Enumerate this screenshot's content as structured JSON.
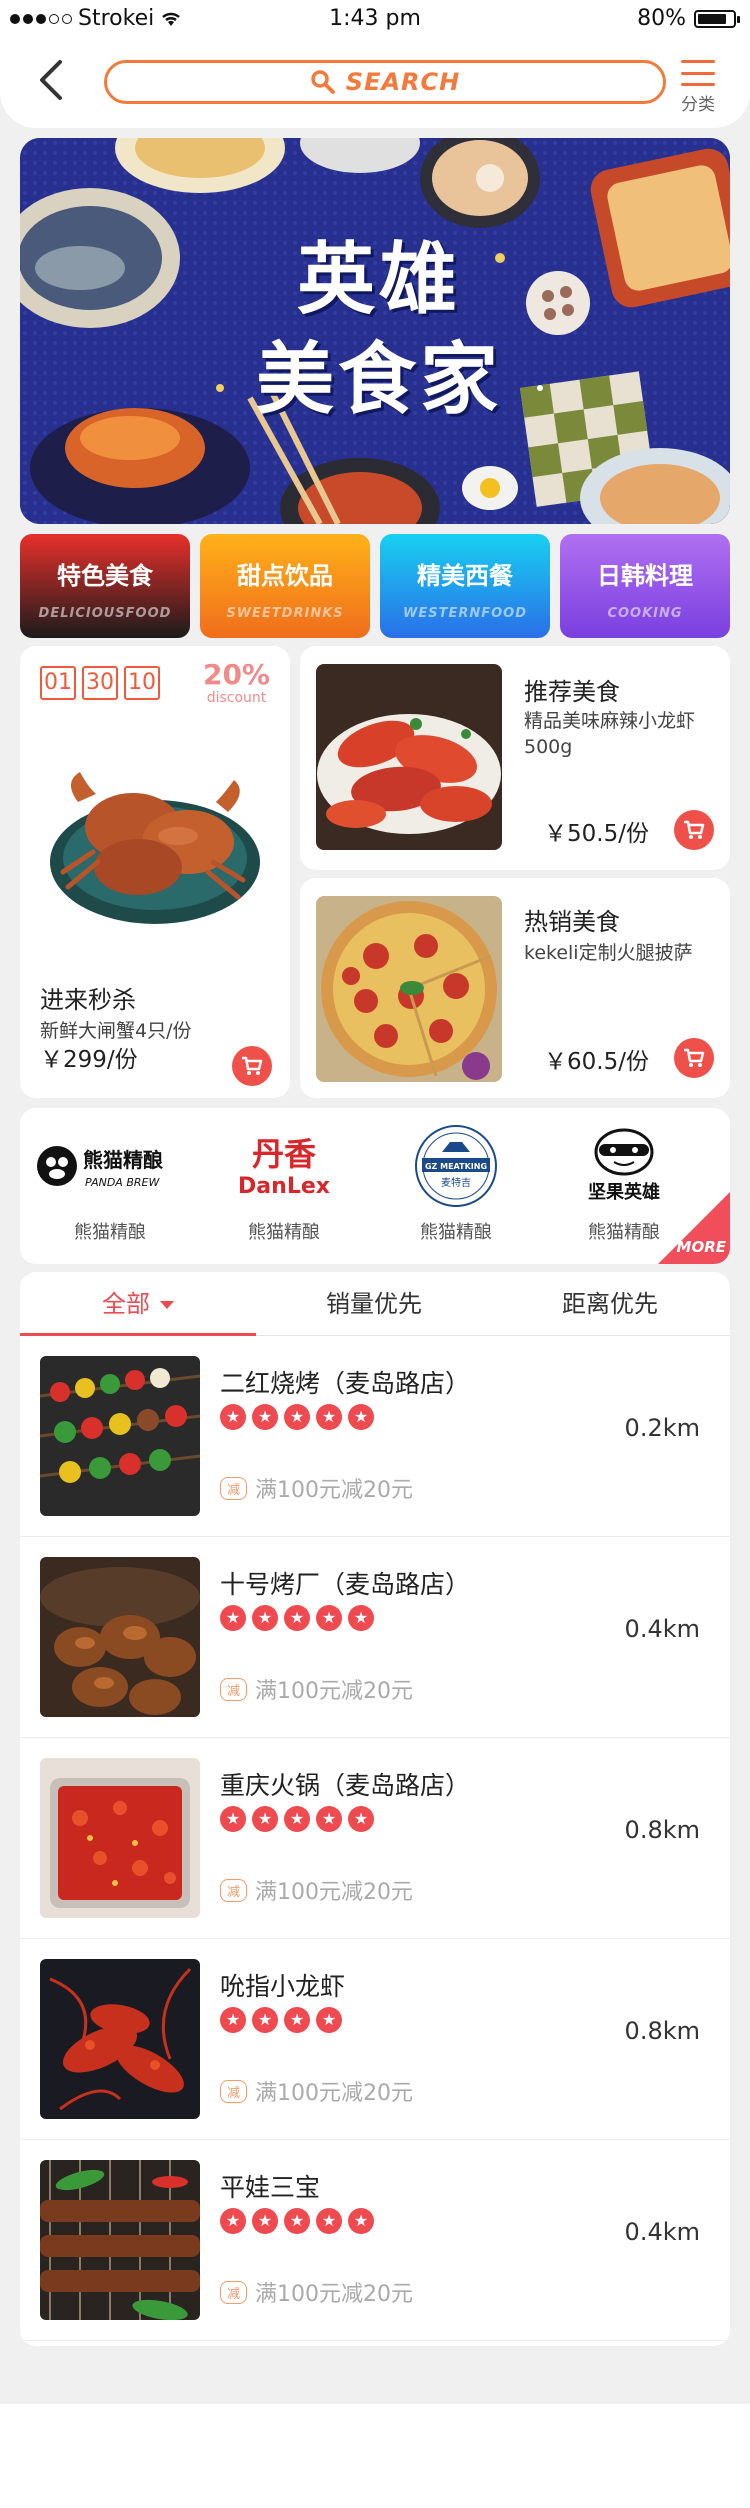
{
  "status": {
    "carrier": "Strokei",
    "time": "1:43 pm",
    "battery": "80%"
  },
  "header": {
    "search_placeholder": "SEARCH",
    "category_label": "分类"
  },
  "banner": {
    "title_line1": "英雄",
    "title_line2": "美食家"
  },
  "categories": [
    {
      "label": "特色美食",
      "sub": "DELICIOUSFOOD",
      "from": "#e8302b",
      "to": "#1b1b1b"
    },
    {
      "label": "甜点饮品",
      "sub": "SWEETDRINKS",
      "from": "#ffb11a",
      "to": "#f06d1c"
    },
    {
      "label": "精美西餐",
      "sub": "WESTERNFOOD",
      "from": "#18d0f0",
      "to": "#2a6fe8"
    },
    {
      "label": "日韩料理",
      "sub": "COOKING",
      "from": "#b070f0",
      "to": "#7a3fe0"
    }
  ],
  "flash_sale": {
    "timer": [
      "01",
      "30",
      "10"
    ],
    "discount_pct": "20%",
    "discount_label": "discount",
    "title": "进来秒杀",
    "desc": "新鲜大闸蟹4只/份",
    "price": "￥299/份"
  },
  "recommend": {
    "title": "推荐美食",
    "desc": "精品美味麻辣小龙虾500g",
    "price": "￥50.5/份"
  },
  "hot": {
    "title": "热销美食",
    "desc": "kekeli定制火腿披萨",
    "price": "￥60.5/份"
  },
  "brands": {
    "items": [
      {
        "logo_text": "熊猫精酿",
        "logo_sub": "PANDA BREW",
        "name": "熊猫精酿"
      },
      {
        "logo_text": "丹香",
        "logo_sub": "DanLex",
        "name": "熊猫精酿"
      },
      {
        "logo_text": "GZ MEATKING",
        "logo_sub": "麦特吉",
        "name": "熊猫精酿"
      },
      {
        "logo_text": "坚果英雄",
        "logo_sub": "",
        "name": "熊猫精酿"
      }
    ],
    "more": "MORE"
  },
  "sort_tabs": [
    "全部",
    "销量优先",
    "距离优先"
  ],
  "restaurants": [
    {
      "name": "二红烧烤（麦岛路店）",
      "stars": 5,
      "distance": "0.2km",
      "tag": "减",
      "promo": "满100元减20元"
    },
    {
      "name": "十号烤厂（麦岛路店）",
      "stars": 5,
      "distance": "0.4km",
      "tag": "减",
      "promo": "满100元减20元"
    },
    {
      "name": "重庆火锅（麦岛路店）",
      "stars": 5,
      "distance": "0.8km",
      "tag": "减",
      "promo": "满100元减20元"
    },
    {
      "name": "吮指小龙虾",
      "stars": 4,
      "distance": "0.8km",
      "tag": "减",
      "promo": "满100元减20元"
    },
    {
      "name": "平娃三宝",
      "stars": 5,
      "distance": "0.4km",
      "tag": "减",
      "promo": "满100元减20元"
    }
  ],
  "colors": {
    "accent": "#ef4a50",
    "search_border": "#f47a3c",
    "banner_bg": "#27308f"
  }
}
